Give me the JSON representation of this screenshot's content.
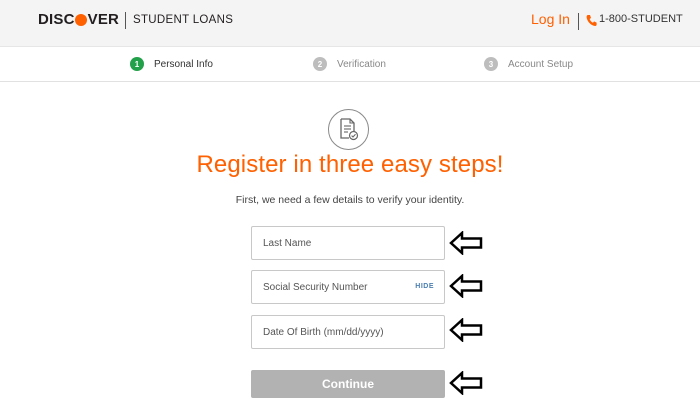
{
  "header": {
    "brand_left": "DISC",
    "brand_right": "VER",
    "brand_sub": "STUDENT LOANS",
    "login_label": "Log In",
    "phone": "1-800-STUDENT"
  },
  "steps": [
    {
      "number": "1",
      "label": "Personal Info",
      "state": "active"
    },
    {
      "number": "2",
      "label": "Verification",
      "state": "inactive"
    },
    {
      "number": "3",
      "label": "Account Setup",
      "state": "inactive"
    }
  ],
  "main": {
    "title": "Register in three easy steps!",
    "subtitle": "First, we need a few details to verify your identity.",
    "fields": {
      "last_name_placeholder": "Last Name",
      "ssn_placeholder": "Social Security Number",
      "ssn_hide": "HIDE",
      "dob_placeholder": "Date Of Birth (mm/dd/yyyy)"
    },
    "continue_label": "Continue"
  },
  "colors": {
    "accent": "#ff6000",
    "step_active": "#23a04a",
    "button_disabled": "#b2b2b2"
  },
  "icons": [
    "phone-icon",
    "document-check-icon",
    "arrow-left-icon"
  ]
}
